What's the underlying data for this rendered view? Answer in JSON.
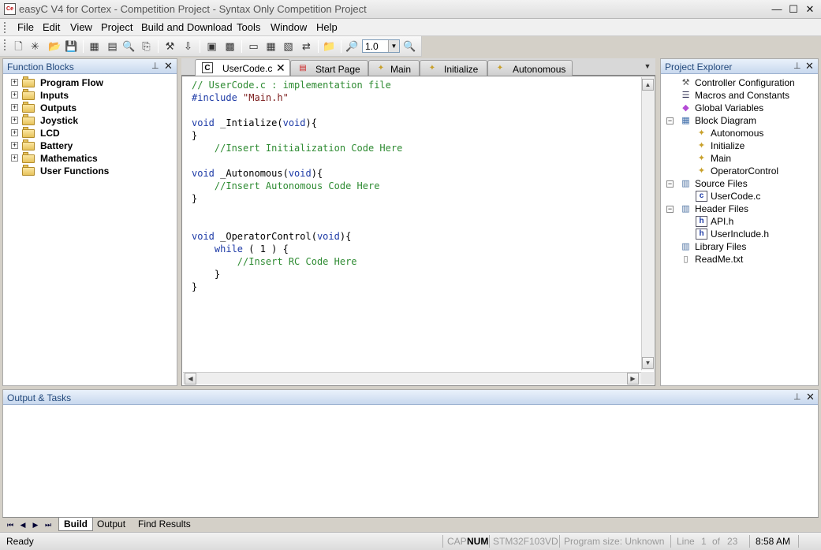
{
  "window": {
    "title": "easyC V4 for Cortex - Competition Project - Syntax Only Competition Project",
    "app_icon_text": "Ce",
    "controls": {
      "minimize": "—",
      "maximize": "☐",
      "close": "✕"
    }
  },
  "menu": {
    "items": [
      "File",
      "Edit",
      "View",
      "Project",
      "Build and Download",
      "Tools",
      "Window",
      "Help"
    ]
  },
  "toolbar": {
    "icons": [
      "new-file-icon",
      "new-project-icon",
      "open-icon",
      "save-icon",
      "flowchart-icon",
      "blocks-icon",
      "find-icon",
      "replace-icon",
      "build-icon",
      "download-icon",
      "terminal-icon",
      "grid-icon",
      "monitor-icon",
      "controller-icon",
      "folder-icon",
      "zoom-in-icon",
      "zoom-out-icon"
    ],
    "zoom_value": "1.0"
  },
  "function_blocks": {
    "title": "Function Blocks",
    "items": [
      {
        "label": "Program Flow",
        "expandable": true
      },
      {
        "label": "Inputs",
        "expandable": true
      },
      {
        "label": "Outputs",
        "expandable": true
      },
      {
        "label": "Joystick",
        "expandable": true
      },
      {
        "label": "LCD",
        "expandable": true
      },
      {
        "label": "Battery",
        "expandable": true
      },
      {
        "label": "Mathematics",
        "expandable": true
      },
      {
        "label": "User Functions",
        "expandable": false
      }
    ]
  },
  "tabs": [
    {
      "label": "UserCode.c",
      "active": true,
      "close": "✕"
    },
    {
      "label": "Start Page",
      "active": false
    },
    {
      "label": "Main",
      "active": false
    },
    {
      "label": "Initialize",
      "active": false
    },
    {
      "label": "Autonomous",
      "active": false
    }
  ],
  "editor": {
    "lines": [
      [
        {
          "t": "// UserCode.c : implementation file",
          "c": "comment"
        }
      ],
      [
        {
          "t": "#include ",
          "c": "keyword"
        },
        {
          "t": "\"Main.h\"",
          "c": "string"
        }
      ],
      [],
      [
        {
          "t": "void",
          "c": "keyword"
        },
        {
          "t": " _Intialize(",
          "c": "plain"
        },
        {
          "t": "void",
          "c": "keyword"
        },
        {
          "t": "){",
          "c": "plain"
        }
      ],
      [
        {
          "t": "}",
          "c": "plain"
        }
      ],
      [
        {
          "t": "    //Insert Initialization Code Here",
          "c": "comment"
        }
      ],
      [],
      [
        {
          "t": "void",
          "c": "keyword"
        },
        {
          "t": " _Autonomous(",
          "c": "plain"
        },
        {
          "t": "void",
          "c": "keyword"
        },
        {
          "t": "){",
          "c": "plain"
        }
      ],
      [
        {
          "t": "    //Insert Autonomous Code Here",
          "c": "comment"
        }
      ],
      [
        {
          "t": "}",
          "c": "plain"
        }
      ],
      [],
      [],
      [
        {
          "t": "void",
          "c": "keyword"
        },
        {
          "t": " _OperatorControl(",
          "c": "plain"
        },
        {
          "t": "void",
          "c": "keyword"
        },
        {
          "t": "){",
          "c": "plain"
        }
      ],
      [
        {
          "t": "    ",
          "c": "plain"
        },
        {
          "t": "while",
          "c": "keyword"
        },
        {
          "t": " ( 1 ) {",
          "c": "plain"
        }
      ],
      [
        {
          "t": "        //Insert RC Code Here",
          "c": "comment"
        }
      ],
      [
        {
          "t": "    }",
          "c": "plain"
        }
      ],
      [
        {
          "t": "}",
          "c": "plain"
        }
      ]
    ]
  },
  "project_explorer": {
    "title": "Project Explorer",
    "items": [
      {
        "label": "Controller Configuration",
        "icon": "wrench-icon"
      },
      {
        "label": "Macros and Constants",
        "icon": "list-icon"
      },
      {
        "label": "Global Variables",
        "icon": "diamond-icon"
      },
      {
        "label": "Block Diagram",
        "icon": "diagram-icon"
      },
      {
        "label": "Autonomous",
        "icon": "function-icon"
      },
      {
        "label": "Initialize",
        "icon": "function-icon"
      },
      {
        "label": "Main",
        "icon": "function-icon"
      },
      {
        "label": "OperatorControl",
        "icon": "function-icon"
      },
      {
        "label": "Source Files",
        "icon": "files-icon"
      },
      {
        "label": "UserCode.c",
        "icon": "c-file-icon"
      },
      {
        "label": "Header Files",
        "icon": "files-icon"
      },
      {
        "label": "API.h",
        "icon": "h-file-icon"
      },
      {
        "label": "UserInclude.h",
        "icon": "h-file-icon"
      },
      {
        "label": "Library Files",
        "icon": "files-icon"
      },
      {
        "label": "ReadMe.txt",
        "icon": "text-file-icon"
      }
    ]
  },
  "output": {
    "title": "Output & Tasks",
    "tabs": [
      "Build",
      "Output",
      "Find Results"
    ]
  },
  "status": {
    "ready": "Ready",
    "cap": "CAP",
    "num": "NUM",
    "device": "STM32F103VD",
    "program_size": "Program size: Unknown",
    "line": "Line",
    "line_num": "1",
    "of": "of",
    "total_lines": "23",
    "time": "8:58 AM"
  },
  "colors": {
    "comment": "#2e8b32",
    "keyword": "#1d3aa6",
    "panel_header": "#c8d8ee",
    "panel_title": "#23497c"
  }
}
